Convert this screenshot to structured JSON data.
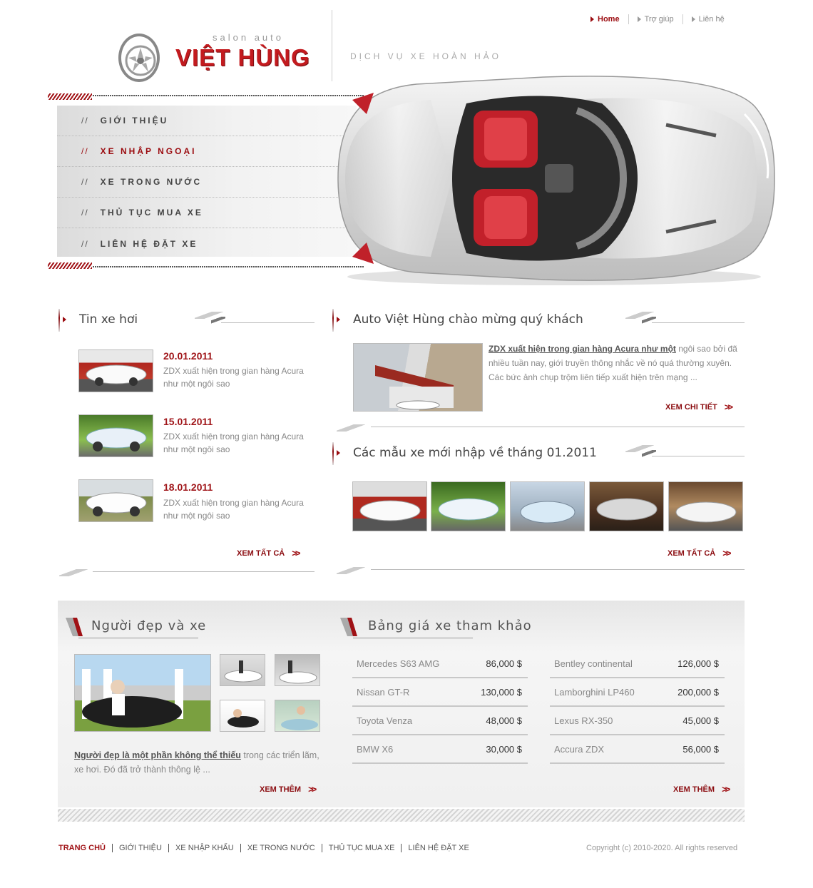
{
  "top_nav": [
    {
      "label": "Home"
    },
    {
      "label": "Trợ giúp"
    },
    {
      "label": "Liên hệ"
    }
  ],
  "logo": {
    "sub": "salon auto",
    "main": "VIỆT HÙNG",
    "tagline": "DỊCH VỤ XE HOÀN HẢO"
  },
  "menu": [
    {
      "label": "GIỚI THIỆU",
      "active": false
    },
    {
      "label": "XE NHẬP NGOẠI",
      "active": true
    },
    {
      "label": "XE TRONG NƯỚC",
      "active": false
    },
    {
      "label": "THỦ TỤC MUA XE",
      "active": false
    },
    {
      "label": "LIÊN HỆ ĐẶT XE",
      "active": false
    }
  ],
  "menu_prefix": "//",
  "news": {
    "title": "Tin xe hơi",
    "items": [
      {
        "date": "20.01.2011",
        "text": "ZDX xuất hiện trong gian hàng Acura như một ngôi sao"
      },
      {
        "date": "15.01.2011",
        "text": "ZDX xuất hiện trong gian hàng Acura như một ngôi sao"
      },
      {
        "date": "18.01.2011",
        "text": "ZDX xuất hiện trong gian hàng Acura như một ngôi sao"
      }
    ],
    "more": "XEM TẤT CẢ"
  },
  "welcome": {
    "title": "Auto Việt Hùng chào mừng quý khách",
    "link_text": "ZDX xuất hiện trong gian hàng Acura như một",
    "body": " ngôi sao bởi đã nhiều tuần nay, giới truyền thông nhắc về nó quá thường xuyên. Các bức ảnh chụp trộm liên tiếp xuất hiện trên mạng ...",
    "more": "XEM CHI TIẾT"
  },
  "new_models": {
    "title": "Các mẫu xe mới nhập về tháng 01.2011",
    "more": "XEM TẤT CẢ"
  },
  "beauty": {
    "title": "Người đẹp và xe",
    "link_text": "Người đẹp là một phần không thể thiếu",
    "body": " trong các triển lãm, xe hơi. Đó đã trở thành thông lệ ...",
    "more": "XEM THÊM"
  },
  "prices": {
    "title": "Bảng giá xe tham khảo",
    "left": [
      {
        "name": "Mercedes S63 AMG",
        "price": "86,000 $"
      },
      {
        "name": "Nissan GT-R",
        "price": "130,000 $"
      },
      {
        "name": "Toyota Venza",
        "price": "48,000 $"
      },
      {
        "name": "BMW X6",
        "price": "30,000 $"
      }
    ],
    "right": [
      {
        "name": "Bentley continental",
        "price": "126,000 $"
      },
      {
        "name": "Lamborghini LP460",
        "price": "200,000 $"
      },
      {
        "name": "Lexus RX-350",
        "price": "45,000 $"
      },
      {
        "name": "Accura ZDX",
        "price": "56,000 $"
      }
    ],
    "more": "XEM THÊM"
  },
  "footer": {
    "links": [
      "TRANG CHỦ",
      "GIỚI THIỆU",
      "XE NHẬP KHẨU",
      "XE TRONG NƯỚC",
      "THỦ TỤC MUA XE",
      "LIÊN HỆ ĐẶT XE"
    ],
    "copyright": "Copyright (c) 2010-2020. All rights reserved"
  },
  "colors": {
    "accent": "#9b0c10",
    "brand_red": "#c31b1f"
  }
}
